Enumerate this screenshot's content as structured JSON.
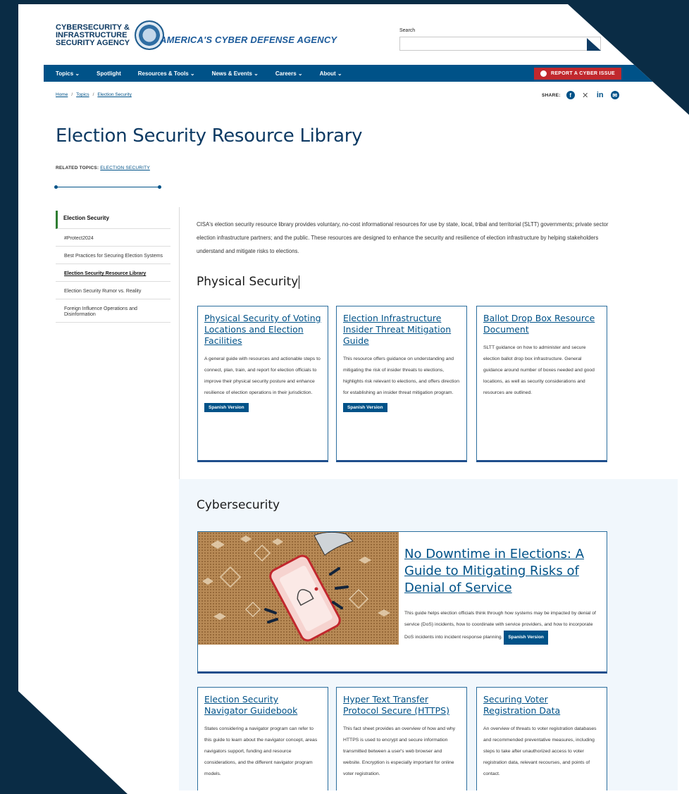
{
  "header": {
    "agency_name": "CYBERSECURITY & INFRASTRUCTURE SECURITY AGENCY",
    "tagline": "AMERICA'S CYBER DEFENSE AGENCY",
    "search_label": "Search",
    "search_placeholder": ""
  },
  "nav": {
    "items": [
      {
        "label": "Topics ⌄"
      },
      {
        "label": "Spotlight"
      },
      {
        "label": "Resources & Tools ⌄"
      },
      {
        "label": "News & Events ⌄"
      },
      {
        "label": "Careers ⌄"
      },
      {
        "label": "About ⌄"
      }
    ],
    "report_label": "REPORT A CYBER ISSUE"
  },
  "breadcrumb": {
    "items": [
      "Home",
      "Topics",
      "Election Security"
    ],
    "sep": "/"
  },
  "share": {
    "label": "SHARE:",
    "icons": [
      "facebook-icon",
      "x-icon",
      "linkedin-icon",
      "email-icon"
    ]
  },
  "page": {
    "title": "Election Security Resource Library",
    "related_label": "RELATED TOPICS:",
    "related_link": "ELECTION SECURITY"
  },
  "sidebar": {
    "heading": "Election Security",
    "items": [
      {
        "label": "#Protect2024"
      },
      {
        "label": "Best Practices for Securing Election Systems"
      },
      {
        "label": "Election Security Resource Library"
      },
      {
        "label": "Election Security Rumor vs. Reality"
      },
      {
        "label": "Foreign Influence Operations and Disinformation"
      }
    ]
  },
  "intro": "CISA's election security resource library provides voluntary, no-cost informational resources for use by state, local, tribal and territorial (SLTT) governments; private sector election infrastructure partners; and the public. These resources are designed to enhance the security and resilience of election infrastructure by helping stakeholders understand and mitigate risks to elections.",
  "physical": {
    "heading": "Physical Security",
    "cards": [
      {
        "title": "Physical Security of Voting Locations and Election Facilities",
        "desc": "A general guide with resources and actionable steps to connect, plan, train, and report for election officials to improve their physical security posture and enhance resilience of election operations in their jurisdiction.",
        "badge": "Spanish Version"
      },
      {
        "title": "Election Infrastructure Insider Threat Mitigation Guide",
        "desc": "This resource offers guidance on understanding and mitigating the risk of insider threats to elections, highlights risk relevant to elections, and offers direction for establishing an insider threat mitigation program.",
        "badge": "Spanish Version"
      },
      {
        "title": "Ballot Drop Box Resource Document",
        "desc": "SLTT guidance on how to administer and secure election ballot drop box infrastructure. General guidance around number of boxes needed and good locations, as well as security considerations and resources are outlined.",
        "badge": ""
      }
    ]
  },
  "cyber": {
    "heading": "Cybersecurity",
    "feature": {
      "title": "No Downtime in Elections: A Guide to Mitigating Risks of Denial of Service",
      "desc": "This guide helps election officials think through how systems may be impacted by denial of service (DoS) incidents, how to coordinate with service providers, and how to incorporate DoS incidents into incident response planning.",
      "badge": "Spanish Version"
    },
    "cards": [
      {
        "title": "Election Security Navigator Guidebook",
        "desc": "States considering a navigator program can refer to this guide to learn about the navigator concept, areas navigators support, funding and resource considerations, and the different navigator program models."
      },
      {
        "title": "Hyper Text Transfer Protocol Secure (HTTPS)",
        "desc": "This fact sheet provides an overview of how and why HTTPS is used to encrypt and secure information transmitted between a user's web browser and website. Encryption is especially important for online voter registration."
      },
      {
        "title": "Securing Voter Registration Data",
        "desc": "An overview of threats to voter registration databases and recommended preventative measures, including steps to take after unauthorized access to voter registration data, relevant recourses, and points of contact."
      }
    ]
  },
  "colors": {
    "nav_blue": "#005288",
    "report_red": "#c1282d",
    "sidebar_accent": "#2e7d32",
    "page_bg": "#0a2c45"
  }
}
